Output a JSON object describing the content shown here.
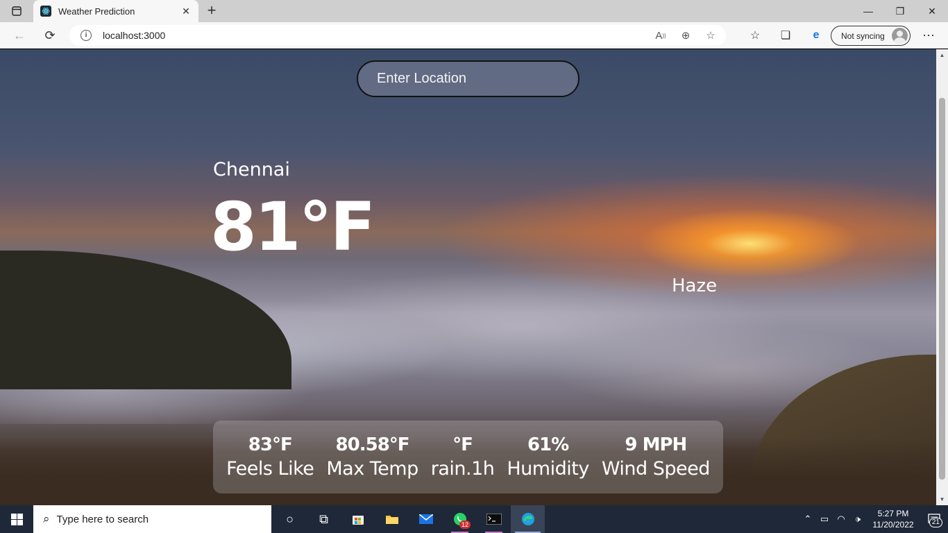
{
  "browser": {
    "tab_title": "Weather Prediction",
    "url": "localhost:3000",
    "sync_label": "Not syncing"
  },
  "weather": {
    "search_placeholder": "Enter Location",
    "city": "Chennai",
    "temperature": "81°F",
    "description": "Haze",
    "stats": [
      {
        "value": "83°F",
        "label": "Feels Like"
      },
      {
        "value": "80.58°F",
        "label": "Max Temp"
      },
      {
        "value": "°F",
        "label": "rain.1h"
      },
      {
        "value": "61%",
        "label": "Humidity"
      },
      {
        "value": "9 MPH",
        "label": "Wind Speed"
      }
    ]
  },
  "taskbar": {
    "search_placeholder": "Type here to search",
    "whatsapp_badge": "12",
    "time": "5:27 PM",
    "date": "11/20/2022",
    "notification_count": "21"
  }
}
